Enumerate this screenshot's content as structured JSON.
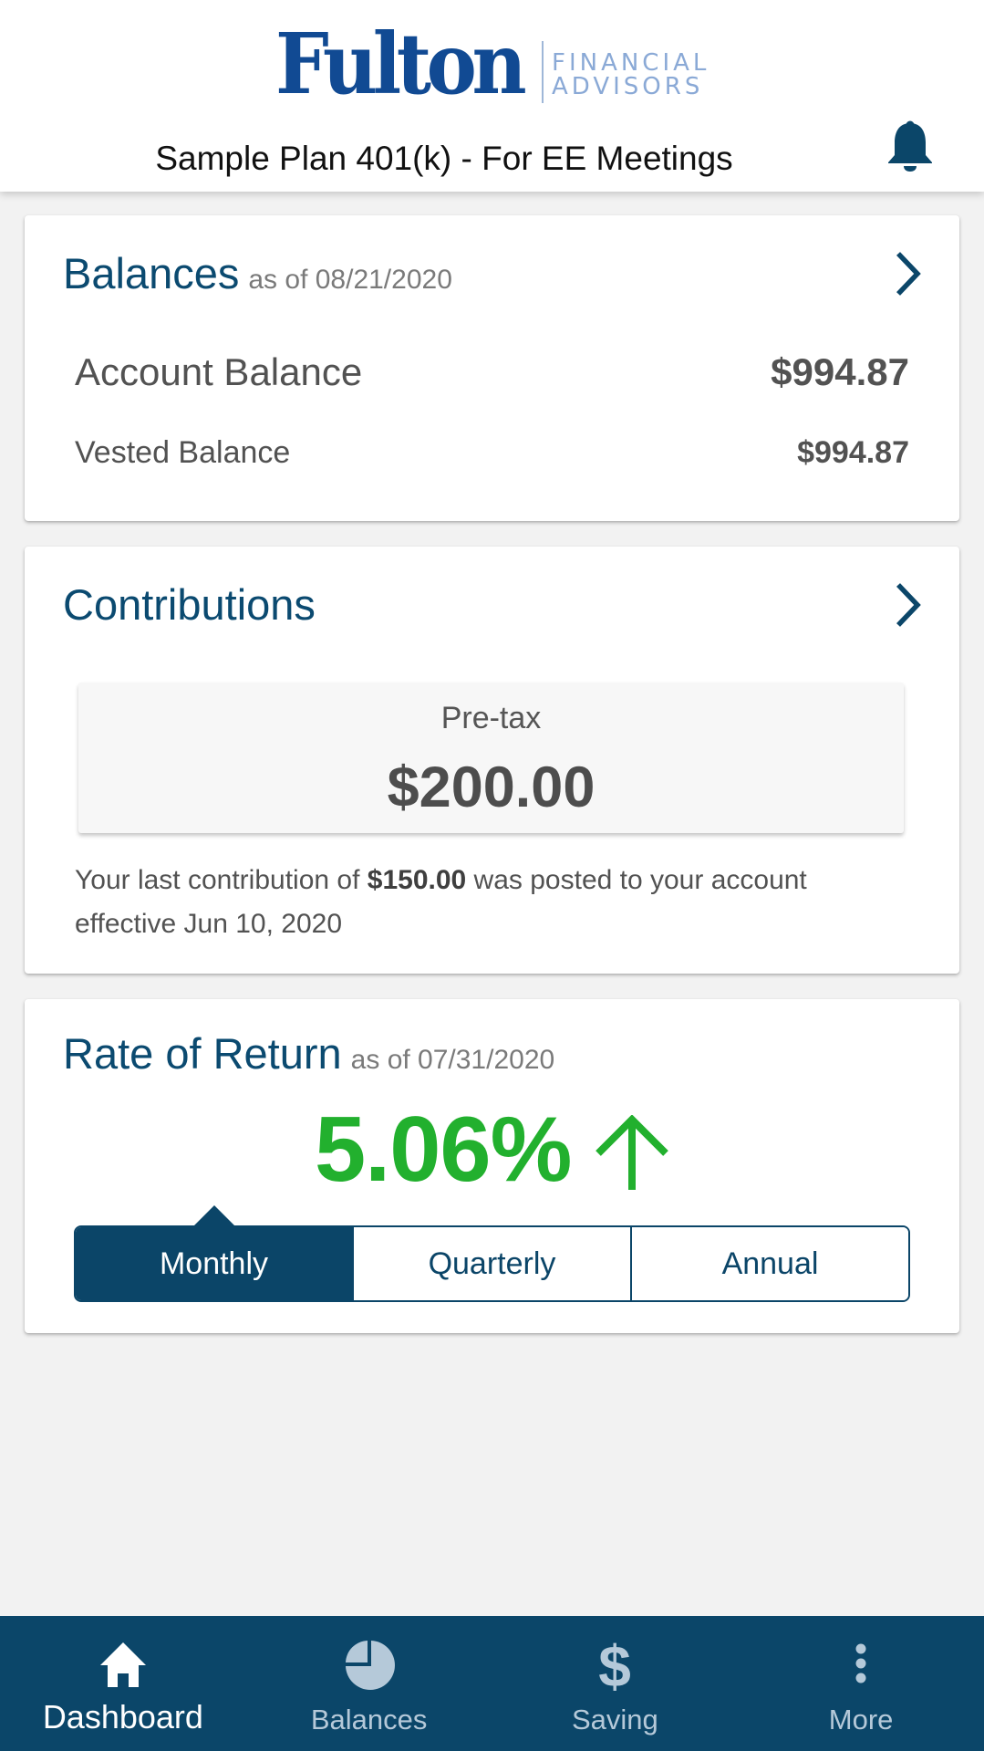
{
  "header": {
    "logo": {
      "brand": "Fulton",
      "sub_line1": "FINANCIAL",
      "sub_line2": "ADVISORS",
      "brand_color": "#114a93",
      "sub_color": "#8aa9d6"
    },
    "plan_title": "Sample Plan 401(k) - For EE Meetings",
    "notification_icon": "bell-icon"
  },
  "balances": {
    "title": "Balances",
    "as_of": "as of 08/21/2020",
    "rows": [
      {
        "label": "Account Balance",
        "value": "$994.87"
      },
      {
        "label": "Vested Balance",
        "value": "$994.87"
      }
    ],
    "nav_icon": "chevron-right-icon"
  },
  "contributions": {
    "title": "Contributions",
    "nav_icon": "chevron-right-icon",
    "tile": {
      "label": "Pre-tax",
      "amount": "$200.00"
    },
    "note": {
      "prefix": "Your last contribution of ",
      "amount": "$150.00",
      "suffix": " was posted to your account effective Jun 10, 2020"
    }
  },
  "rate_of_return": {
    "title": "Rate of Return",
    "as_of": "as of 07/31/2020",
    "value": "5.06%",
    "trend": "up",
    "trend_icon": "arrow-up-icon",
    "positive_color": "#22b02e",
    "periods": [
      {
        "label": "Monthly",
        "active": true
      },
      {
        "label": "Quarterly",
        "active": false
      },
      {
        "label": "Annual",
        "active": false
      }
    ]
  },
  "bottom_nav": {
    "background": "#0b4669",
    "items": [
      {
        "label": "Dashboard",
        "icon": "home-icon",
        "active": true
      },
      {
        "label": "Balances",
        "icon": "pie-chart-icon",
        "active": false
      },
      {
        "label": "Saving",
        "icon": "dollar-icon",
        "active": false
      },
      {
        "label": "More",
        "icon": "more-vertical-icon",
        "active": false
      }
    ]
  }
}
